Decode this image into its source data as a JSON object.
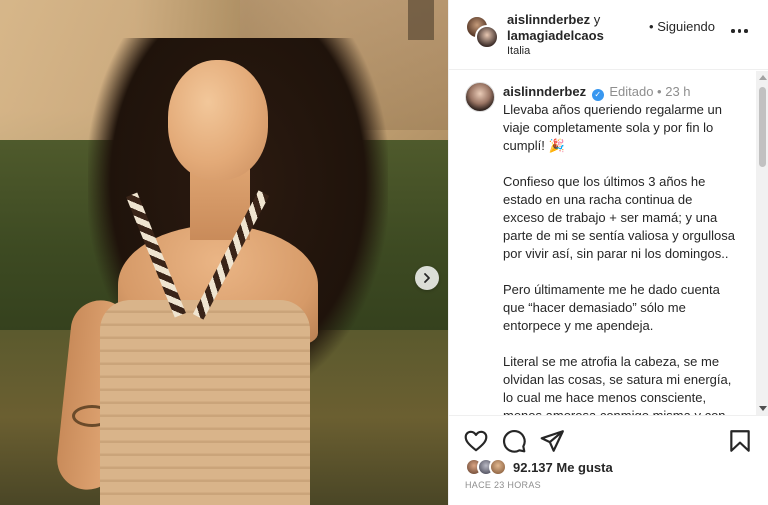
{
  "post": {
    "header": {
      "user1": "aislinnderbez",
      "joiner": "y",
      "user2": "lamagiadelcaos",
      "location": "Italia",
      "follow_prefix": "•",
      "follow_label": "Siguiendo",
      "more_icon": "more-horizontal-icon"
    },
    "caption": {
      "username": "aislinnderbez",
      "verified_icon": "verified-badge-icon",
      "edited": "Editado",
      "dot": "•",
      "time": "23 h",
      "paragraphs": [
        "Llevaba años queriendo regalarme un viaje completamente sola y por fin lo cumplí! 🎉",
        "Confieso que los últimos 3 años he estado en una racha continua de exceso de trabajo + ser mamá; y una parte de mi se sentía valiosa y orgullosa por vivir así, sin parar ni los domingos..",
        "Pero últimamente me he dado cuenta que “hacer demasiado” sólo me entorpece y me apendeja.",
        "Literal se me atrofia la cabeza, se me olvidan las cosas, se satura mi energía, lo cual me hace menos consciente, menos amorosa conmigo misma y con los demás y entro constantemente en"
      ]
    },
    "actions": {
      "like_icon": "heart-icon",
      "comment_icon": "comment-icon",
      "share_icon": "send-icon",
      "save_icon": "bookmark-icon"
    },
    "likes": {
      "count_label": "92.137 Me gusta"
    },
    "timestamp": "HACE 23 HORAS"
  },
  "carousel": {
    "next_icon": "chevron-right-icon"
  },
  "colors": {
    "text": "#262626",
    "muted": "#8e8e8e",
    "verified": "#3897f0",
    "border": "#efefef"
  }
}
